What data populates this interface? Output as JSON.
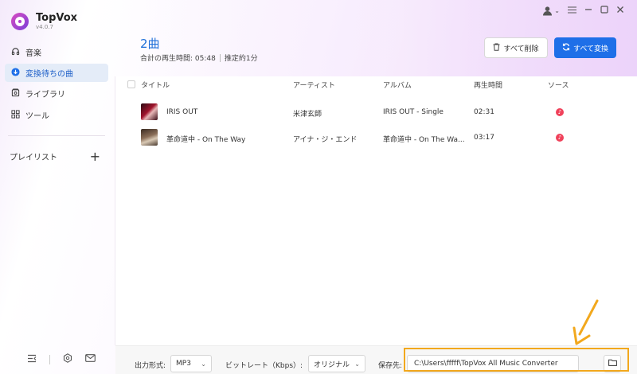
{
  "app": {
    "name": "TopVox",
    "version": "v4.0.7"
  },
  "sidebar": {
    "items": [
      {
        "label": "音楽",
        "icon": "headphones-icon"
      },
      {
        "label": "変換待ちの曲",
        "icon": "download-icon"
      },
      {
        "label": "ライブラリ",
        "icon": "library-icon"
      },
      {
        "label": "ツール",
        "icon": "grid-icon"
      }
    ],
    "playlist_label": "プレイリスト"
  },
  "header": {
    "count": "2曲",
    "total_time": "合計の再生時間: 05:48",
    "estimate": "推定約1分",
    "delete_all_label": "すべて削除",
    "convert_all_label": "すべて変換"
  },
  "table": {
    "columns": [
      "タイトル",
      "アーティスト",
      "アルバム",
      "再生時間",
      "ソース"
    ],
    "rows": [
      {
        "title": "IRIS OUT",
        "artist": "米津玄師",
        "album": "IRIS OUT - Single",
        "duration": "02:31"
      },
      {
        "title": "革命道中 - On The Way",
        "artist": "アイナ・ジ・エンド",
        "album": "革命道中 - On The Wa...",
        "duration": "03:17"
      }
    ]
  },
  "footer": {
    "format_label": "出力形式:",
    "format_value": "MP3",
    "bitrate_label": "ビットレート（Kbps）:",
    "bitrate_value": "オリジナル",
    "save_label": "保存先:",
    "save_path": "C:\\Users\\fffff\\TopVox All Music Converter"
  },
  "colors": {
    "accent": "#1e6fe8",
    "active_nav_bg": "#e4ecf8",
    "highlight": "#f2a81d",
    "source_icon": "#f0415a"
  }
}
